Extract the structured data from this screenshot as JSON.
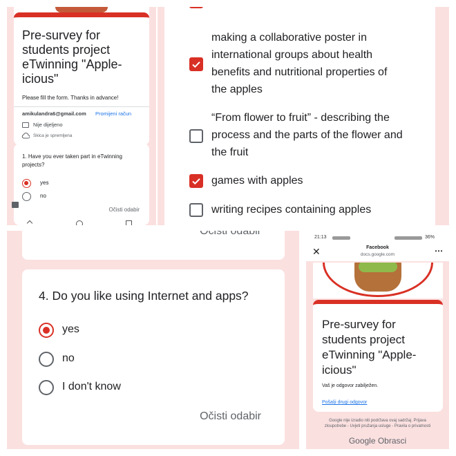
{
  "top_left": {
    "form_title": [
      "Pre-survey for",
      "students project",
      "eTwinning \"Apple-",
      "icious\""
    ],
    "description": "Please fill the form. Thanks in advance!",
    "account_email": "amikulandra6@gmail.com",
    "switch_account": "Promijeni račun",
    "not_shared": "Nije dijeljeno",
    "draft_saved": "Skica je spremljena",
    "question1": [
      "1. Have you ever taken part in eTwinning",
      "projects?"
    ],
    "options": [
      "yes",
      "no"
    ],
    "selected": "yes",
    "clear_selection": "Očisti odabir"
  },
  "top_right": {
    "options": [
      {
        "lines": [
          "making a collaborative poster in",
          "international groups about  health",
          "benefits and  nutritional properties of",
          "the apples"
        ],
        "checked": true
      },
      {
        "lines": [
          "“From flower to fruit” - describing the",
          "process and the parts of the flower and",
          "the fruit"
        ],
        "checked": false
      },
      {
        "lines": [
          "games with apples"
        ],
        "checked": true
      },
      {
        "lines": [
          "writing recipes containing apples"
        ],
        "checked": false
      }
    ]
  },
  "bottom_left": {
    "clear_selection_top": "Očisti odabir",
    "question4": "4. Do you like using Internet and apps?",
    "options": [
      "yes",
      "no",
      "I don't know"
    ],
    "selected": "yes",
    "clear_selection": "Očisti odabir"
  },
  "bottom_right": {
    "status_time": "21:13",
    "status_battery": "36%",
    "browser_app": "Facebook",
    "browser_url": "docs.google.com",
    "form_title": [
      "Pre-survey for",
      "students project",
      "eTwinning \"Apple-",
      "icious\""
    ],
    "response_recorded": "Vaš je odgovor zabilježen.",
    "submit_another": "Pošalji drugi odgovor",
    "footer_lines": [
      "Google nije izradio niti podržava ovaj sadržaj. Prijava",
      "zloupotrebe - Uvjeti pružanja usluge - Pravila o privatnosti"
    ],
    "google_logo": "Google Obrasci"
  },
  "colors": {
    "accent": "#d93025",
    "background": "#fbe0e0",
    "link": "#1a73e8"
  }
}
